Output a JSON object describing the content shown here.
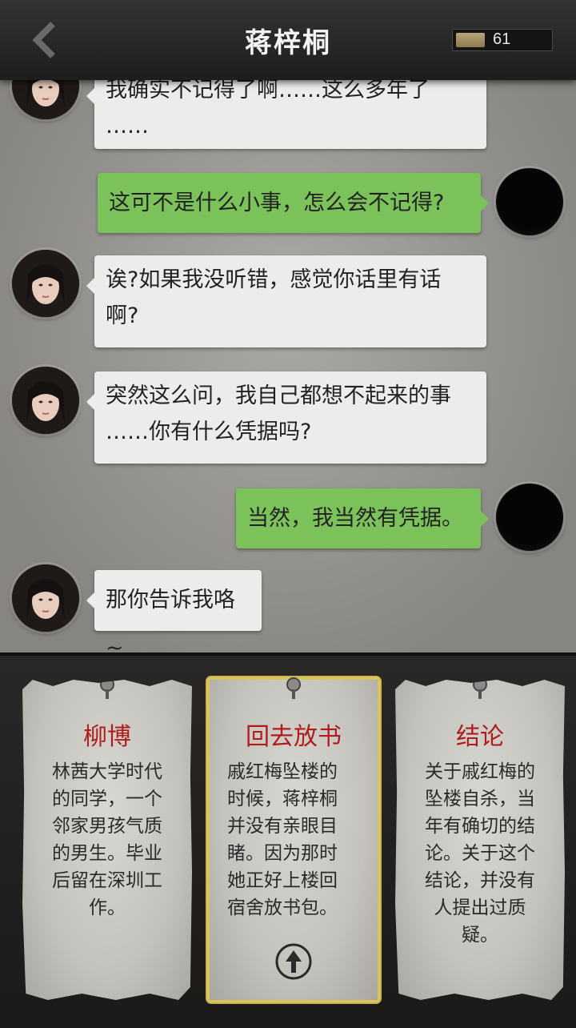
{
  "header": {
    "title": "蒋梓桐",
    "coins": "61",
    "back_icon": "chevron-left-icon"
  },
  "chat": {
    "messages": [
      {
        "from": "npc",
        "lines": [
          "我确实不记得了啊……这么多年了",
          "……"
        ]
      },
      {
        "from": "me",
        "lines": [
          "这可不是什么小事，怎么会不记得?"
        ]
      },
      {
        "from": "npc",
        "lines": [
          "诶?如果我没听错，感觉你话里有话",
          "啊?"
        ]
      },
      {
        "from": "npc",
        "lines": [
          "突然这么问，我自己都想不起来的事",
          "……你有什么凭据吗?"
        ]
      },
      {
        "from": "me",
        "lines": [
          "当然，我当然有凭据。"
        ]
      },
      {
        "from": "npc",
        "lines": [
          "那你告诉我咯~"
        ]
      }
    ]
  },
  "cards": [
    {
      "title": "柳博",
      "lines": [
        "林茜大学时代",
        "的同学，一个",
        "邻家男孩气质",
        "的男生。毕业",
        "后留在深圳工",
        "作。"
      ]
    },
    {
      "title": "回去放书",
      "lines": [
        "戚红梅坠楼的",
        "时候，蒋梓桐",
        "并没有亲眼目",
        "睹。因为那时",
        "她正好上楼回",
        "宿舍放书包。"
      ],
      "selected": true
    },
    {
      "title": "结论",
      "lines": [
        "关于戚红梅的",
        "坠楼自杀，当",
        "年有确切的结",
        "论。关于这个",
        "结论，并没有",
        "人提出过质",
        "疑。"
      ]
    }
  ],
  "colors": {
    "npc_bubble": "#ececea",
    "me_bubble": "#7bc25a",
    "card_title": "#b01c1c"
  }
}
